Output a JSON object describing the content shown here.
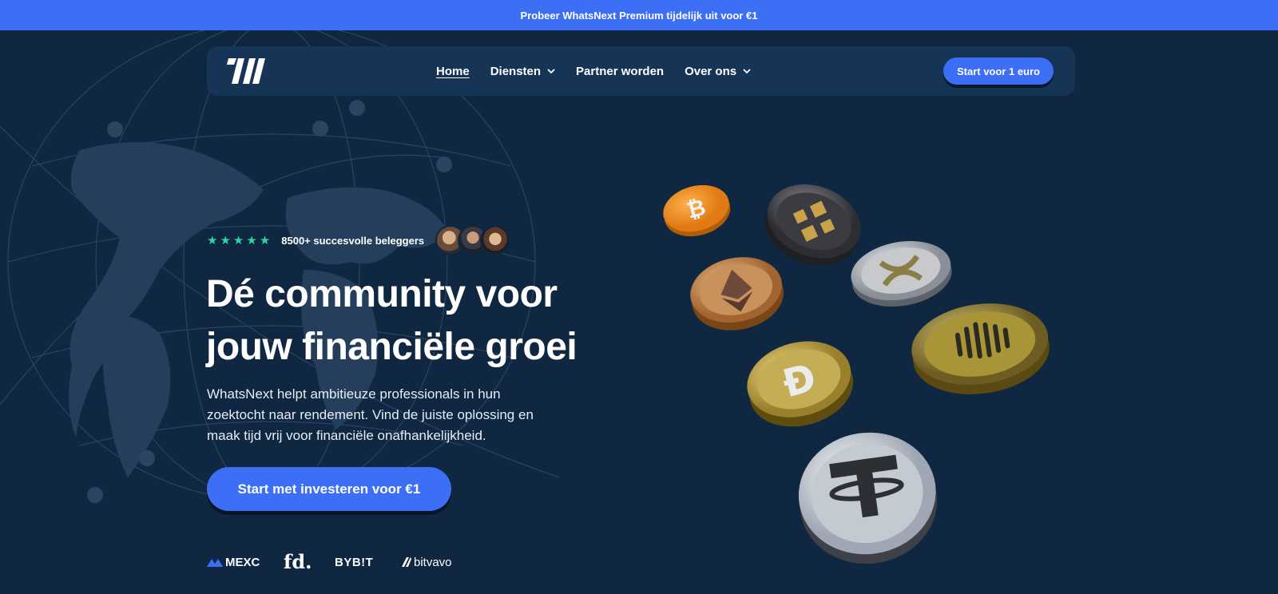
{
  "promo": {
    "text": "Probeer WhatsNext Premium tijdelijk uit voor €1"
  },
  "nav": {
    "logo_alt": "WhatsNext",
    "items": [
      {
        "label": "Home",
        "active": true,
        "dropdown": false
      },
      {
        "label": "Diensten",
        "active": false,
        "dropdown": true
      },
      {
        "label": "Partner worden",
        "active": false,
        "dropdown": false
      },
      {
        "label": "Over ons",
        "active": false,
        "dropdown": true
      }
    ],
    "cta_label": "Start voor 1 euro"
  },
  "hero": {
    "rating_text": "8500+ succesvolle beleggers",
    "stars": 5,
    "headline_line1": "Dé community voor",
    "headline_line2": "jouw financiële groei",
    "subtext": "WhatsNext helpt ambitieuze professionals in hun zoektocht naar rendement. Vind de juiste oplossing en maak tijd vrij voor financiële onafhankelijkheid.",
    "cta_label": "Start met investeren voor €1"
  },
  "partners": {
    "mexc": "MEXC",
    "fd": "fd.",
    "bybit": "BYB!T",
    "bitvavo": "bitvavo"
  },
  "colors": {
    "background": "#0f2741",
    "nav_background": "#163556",
    "accent": "#3d6ef6",
    "star": "#2dd4a4"
  },
  "coins": [
    "bitcoin",
    "binance",
    "ethereum",
    "ripple",
    "cardano",
    "dogecoin",
    "tether"
  ]
}
